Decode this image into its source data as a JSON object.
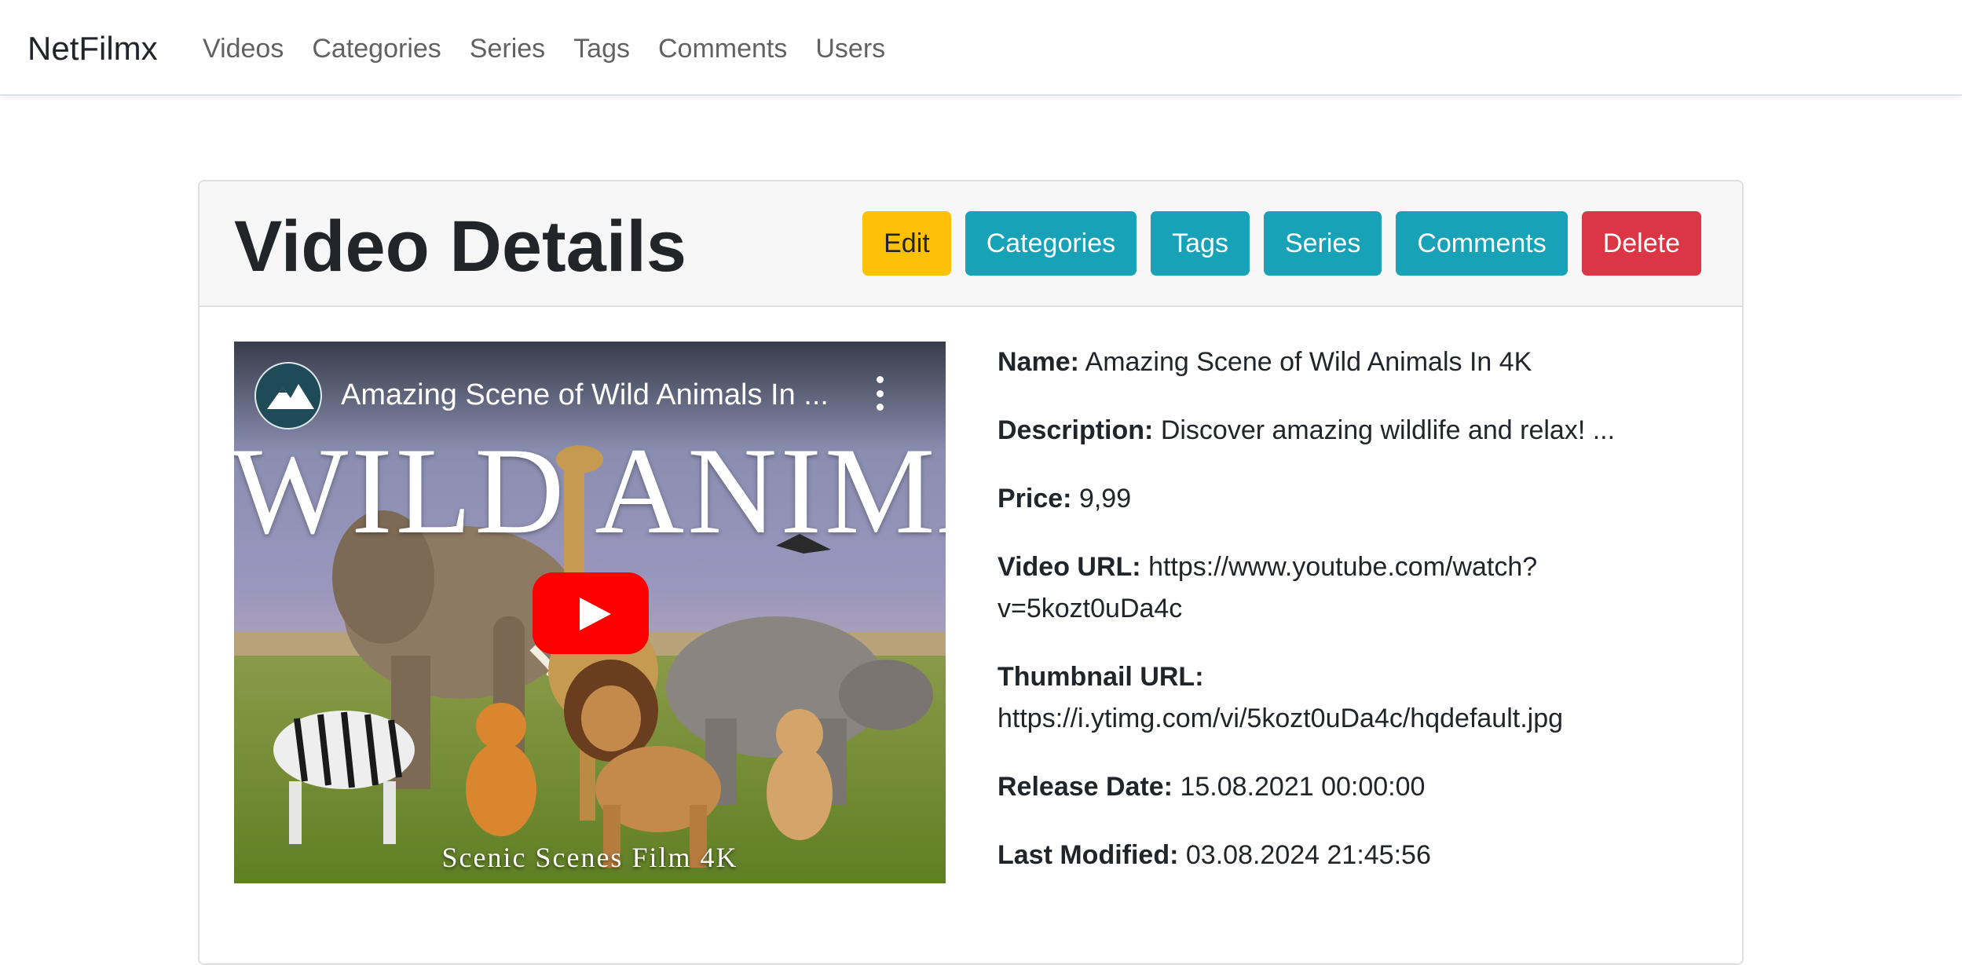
{
  "navbar": {
    "brand": "NetFilmx",
    "links": [
      "Videos",
      "Categories",
      "Series",
      "Tags",
      "Comments",
      "Users"
    ]
  },
  "card": {
    "title": "Video Details",
    "buttons": {
      "edit": "Edit",
      "categories": "Categories",
      "tags": "Tags",
      "series": "Series",
      "comments": "Comments",
      "delete": "Delete"
    }
  },
  "video": {
    "title": "Amazing Scene of Wild Animals In ...",
    "overlay_text": "WILD ANIMALS",
    "caption": "Scenic Scenes Film 4K"
  },
  "details": {
    "name_label": "Name:",
    "name": "Amazing Scene of Wild Animals In 4K",
    "description_label": "Description:",
    "description": "Discover amazing wildlife and relax! ...",
    "price_label": "Price:",
    "price": "9,99",
    "video_url_label": "Video URL:",
    "video_url": "https://www.youtube.com/watch?v=5kozt0uDa4c",
    "thumbnail_url_label": "Thumbnail URL:",
    "thumbnail_url": "https://i.ytimg.com/vi/5kozt0uDa4c/hqdefault.jpg",
    "release_date_label": "Release Date:",
    "release_date": "15.08.2021 00:00:00",
    "last_modified_label": "Last Modified:",
    "last_modified": "03.08.2024 21:45:56"
  },
  "colors": {
    "warning": "#ffc107",
    "info": "#17a2b8",
    "danger": "#dc3545",
    "youtube_red": "#ff0000"
  }
}
